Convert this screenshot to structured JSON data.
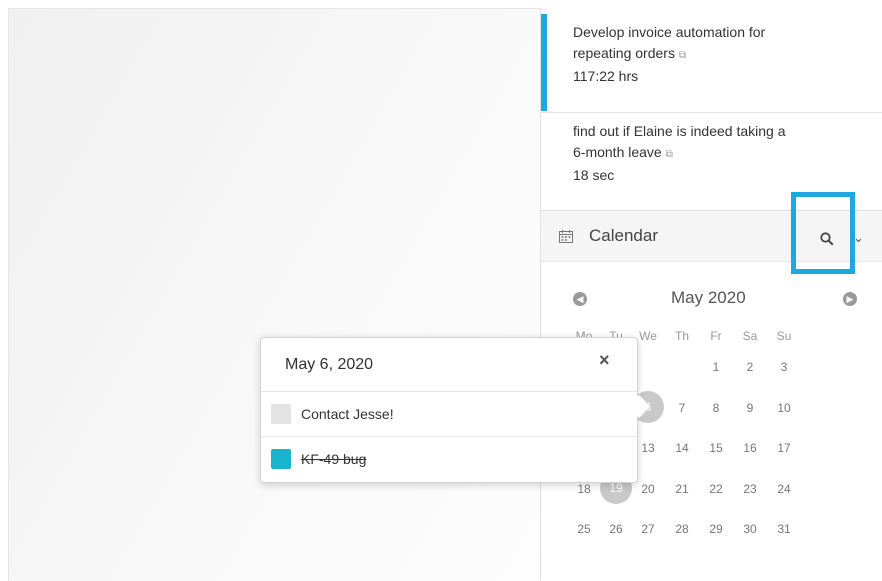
{
  "tasks": [
    {
      "title_line1": "Develop invoice automation for",
      "title_line2": "repeating orders",
      "duration": "117:22 hrs",
      "accent": "#1ea7e1"
    },
    {
      "title_line1": "find out if Elaine is indeed taking a",
      "title_line2": "6-month leave",
      "duration": "18 sec"
    }
  ],
  "calendar": {
    "title": "Calendar",
    "month": "May 2020",
    "weekdays": [
      "Mo",
      "Tu",
      "We",
      "Th",
      "Fr",
      "Sa",
      "Su"
    ],
    "weeks": [
      [
        "",
        "",
        "",
        "",
        "1",
        "2",
        "3"
      ],
      [
        "",
        "",
        "6",
        "7",
        "8",
        "9",
        "10"
      ],
      [
        "",
        "",
        "13",
        "14",
        "15",
        "16",
        "17"
      ],
      [
        "18",
        "19",
        "20",
        "21",
        "22",
        "23",
        "24"
      ],
      [
        "25",
        "26",
        "27",
        "28",
        "29",
        "30",
        "31"
      ]
    ],
    "selected_days": [
      "6",
      "19"
    ]
  },
  "popup": {
    "date": "May 6, 2020",
    "close_glyph": "×",
    "items": [
      {
        "label": "Contact Jesse!",
        "color": "#e3e3e3",
        "done": false
      },
      {
        "label": "KF-49 bug",
        "color": "#17b5cc",
        "done": true
      }
    ]
  },
  "colors": {
    "accent": "#1ea7e1",
    "selected_day": "#c9c9c9"
  }
}
